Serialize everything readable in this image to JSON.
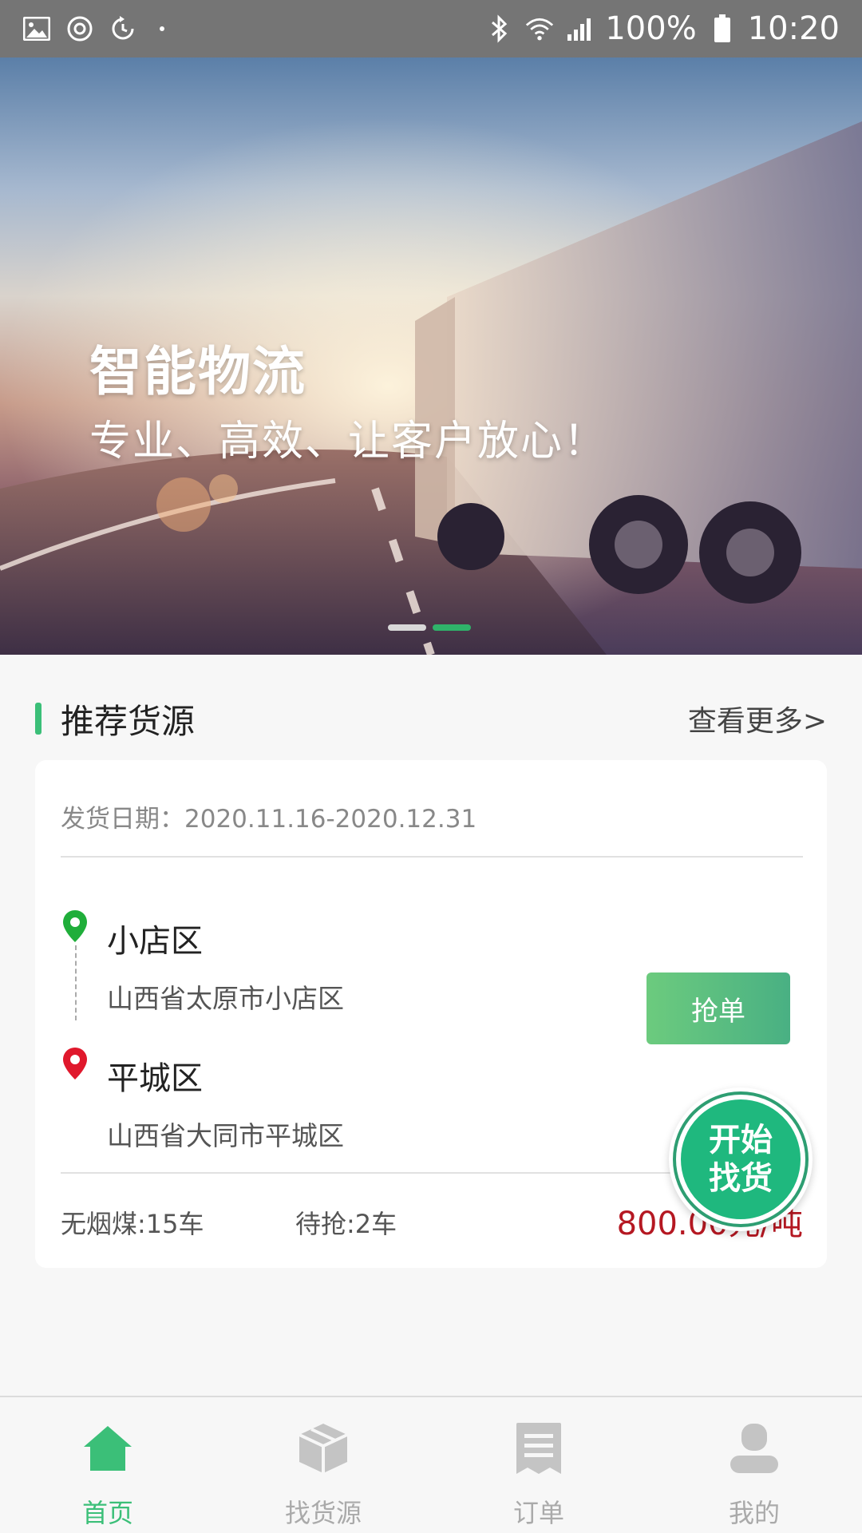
{
  "status_bar": {
    "battery": "100%",
    "time": "10:20"
  },
  "banner": {
    "headline": "智能物流",
    "tagline": "专业、高效、让客户放心！",
    "active_slide_index": 1,
    "slide_count": 2
  },
  "section": {
    "title": "推荐货源",
    "more_label": "查看更多>"
  },
  "cargo": {
    "ship_date": "发货日期：2020.11.16-2020.12.31",
    "from_name": "小店区",
    "from_address": "山西省太原市小店区",
    "to_name": "平城区",
    "to_address": "山西省大同市平城区",
    "grab_label": "抢单",
    "goods": "无烟煤:15车",
    "pending": "待抢:2车",
    "price": "800.00元/吨"
  },
  "fab": {
    "line1": "开始",
    "line2": "找货"
  },
  "tabs": [
    {
      "label": "首页",
      "icon": "home-icon",
      "active": true
    },
    {
      "label": "找货源",
      "icon": "box-icon",
      "active": false
    },
    {
      "label": "订单",
      "icon": "receipt-icon",
      "active": false
    },
    {
      "label": "我的",
      "icon": "user-icon",
      "active": false
    }
  ],
  "colors": {
    "accent": "#3bbf78",
    "price": "#b51822",
    "status_bar": "#757575"
  }
}
